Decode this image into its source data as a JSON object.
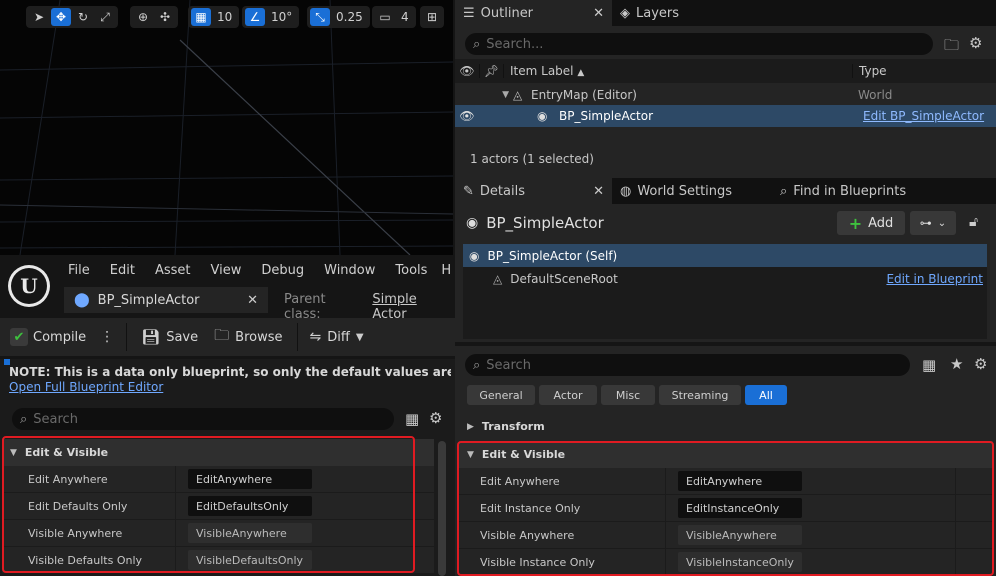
{
  "viewport": {
    "grid_snap": "10",
    "rotation_snap": "10°",
    "scale_snap": "0.25",
    "camera_speed": "4"
  },
  "outliner": {
    "tab_label": "Outliner",
    "layers_tab": "Layers",
    "search_placeholder": "Search...",
    "col_item_label": "Item Label",
    "col_type": "Type",
    "rows": [
      {
        "label": "EntryMap (Editor)",
        "type": "World"
      },
      {
        "label": "BP_SimpleActor",
        "type": "Edit BP_SimpleActor"
      }
    ],
    "status": "1 actors (1 selected)"
  },
  "details": {
    "tab_label": "Details",
    "world_settings_tab": "World Settings",
    "find_tab": "Find in Blueprints",
    "actor_name": "BP_SimpleActor",
    "add_label": "Add",
    "component_self": "BP_SimpleActor (Self)",
    "component_root": "DefaultSceneRoot",
    "edit_in_blueprint": "Edit in Blueprint",
    "search_placeholder": "Search",
    "filters": [
      "General",
      "Actor",
      "Misc",
      "Streaming",
      "All"
    ],
    "transform_label": "Transform",
    "category": "Edit & Visible",
    "props": [
      {
        "label": "Edit Anywhere",
        "value": "EditAnywhere"
      },
      {
        "label": "Edit Instance Only",
        "value": "EditInstanceOnly"
      },
      {
        "label": "Visible Anywhere",
        "value": "VisibleAnywhere"
      },
      {
        "label": "Visible Instance Only",
        "value": "VisibleInstanceOnly"
      }
    ]
  },
  "blueprint_editor": {
    "menu": [
      "File",
      "Edit",
      "Asset",
      "View",
      "Debug",
      "Window",
      "Tools",
      "H"
    ],
    "tab_label": "BP_SimpleActor",
    "parent_class_label": "Parent class:",
    "parent_class_value": "Simple Actor",
    "compile_label": "Compile",
    "save_label": "Save",
    "browse_label": "Browse",
    "diff_label": "Diff",
    "note_text": "NOTE: This is a data only blueprint, so only the default values are shown.  It d",
    "open_full_link": "Open Full Blueprint Editor",
    "search_placeholder": "Search",
    "category": "Edit & Visible",
    "props": [
      {
        "label": "Edit Anywhere",
        "value": "EditAnywhere"
      },
      {
        "label": "Edit Defaults Only",
        "value": "EditDefaultsOnly"
      },
      {
        "label": "Visible Anywhere",
        "value": "VisibleAnywhere"
      },
      {
        "label": "Visible Defaults Only",
        "value": "VisibleDefaultsOnly"
      }
    ]
  },
  "colors": {
    "accent": "#1a6fd6",
    "highlight": "#e01b22",
    "link": "#6fa8ff"
  }
}
